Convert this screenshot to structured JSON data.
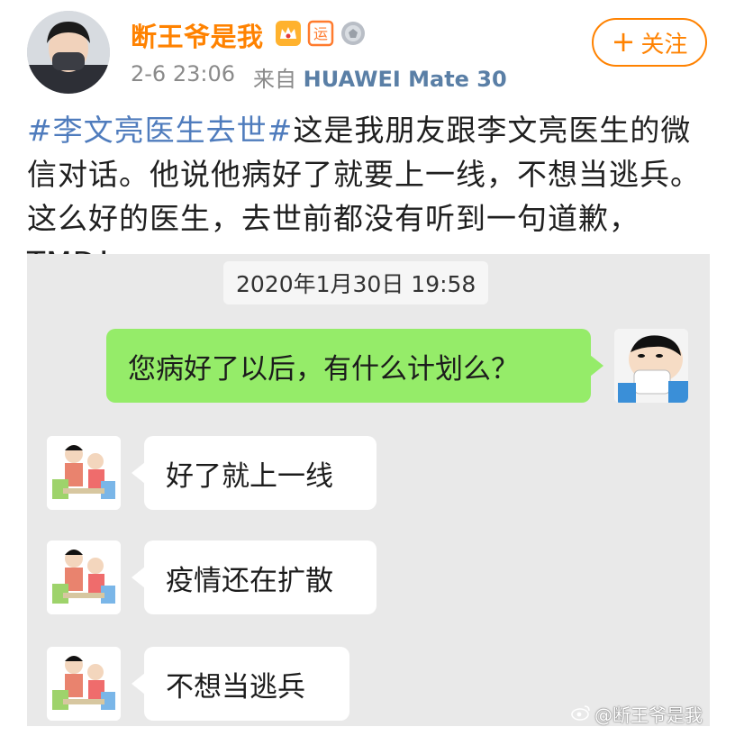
{
  "post": {
    "username": "断王爷是我",
    "date": "2-6 23:06",
    "source": "来自",
    "device": "HUAWEI Mate 30",
    "follow_label": "关注",
    "follow_icon": "plus-icon",
    "hashtag": "#李文亮医生去世#",
    "body": "这是我朋友跟李文亮医生的微信对话。他说他病好了就要上一线，不想当逃兵。这么好的医生，去世前都没有听到一句道歉，TMD！",
    "badges": [
      "crown-badge-icon",
      "yun-badge-icon",
      "medal-badge-icon"
    ],
    "badge_text": {
      "yun": "运"
    }
  },
  "chat": {
    "timestamp": "2020年1月30日 19:58",
    "messages": [
      {
        "direction": "outgoing",
        "text": "您病好了以后，有什么计划么？"
      },
      {
        "direction": "incoming",
        "text": "好了就上一线"
      },
      {
        "direction": "incoming",
        "text": "疫情还在扩散"
      },
      {
        "direction": "incoming",
        "text": "不想当逃兵"
      }
    ]
  },
  "watermark": "@断王爷是我",
  "colors": {
    "brand_orange": "#ff8200",
    "hashtag_blue": "#4f7cbd",
    "wechat_green": "#95ec69",
    "chat_bg": "#e9e9e9"
  }
}
